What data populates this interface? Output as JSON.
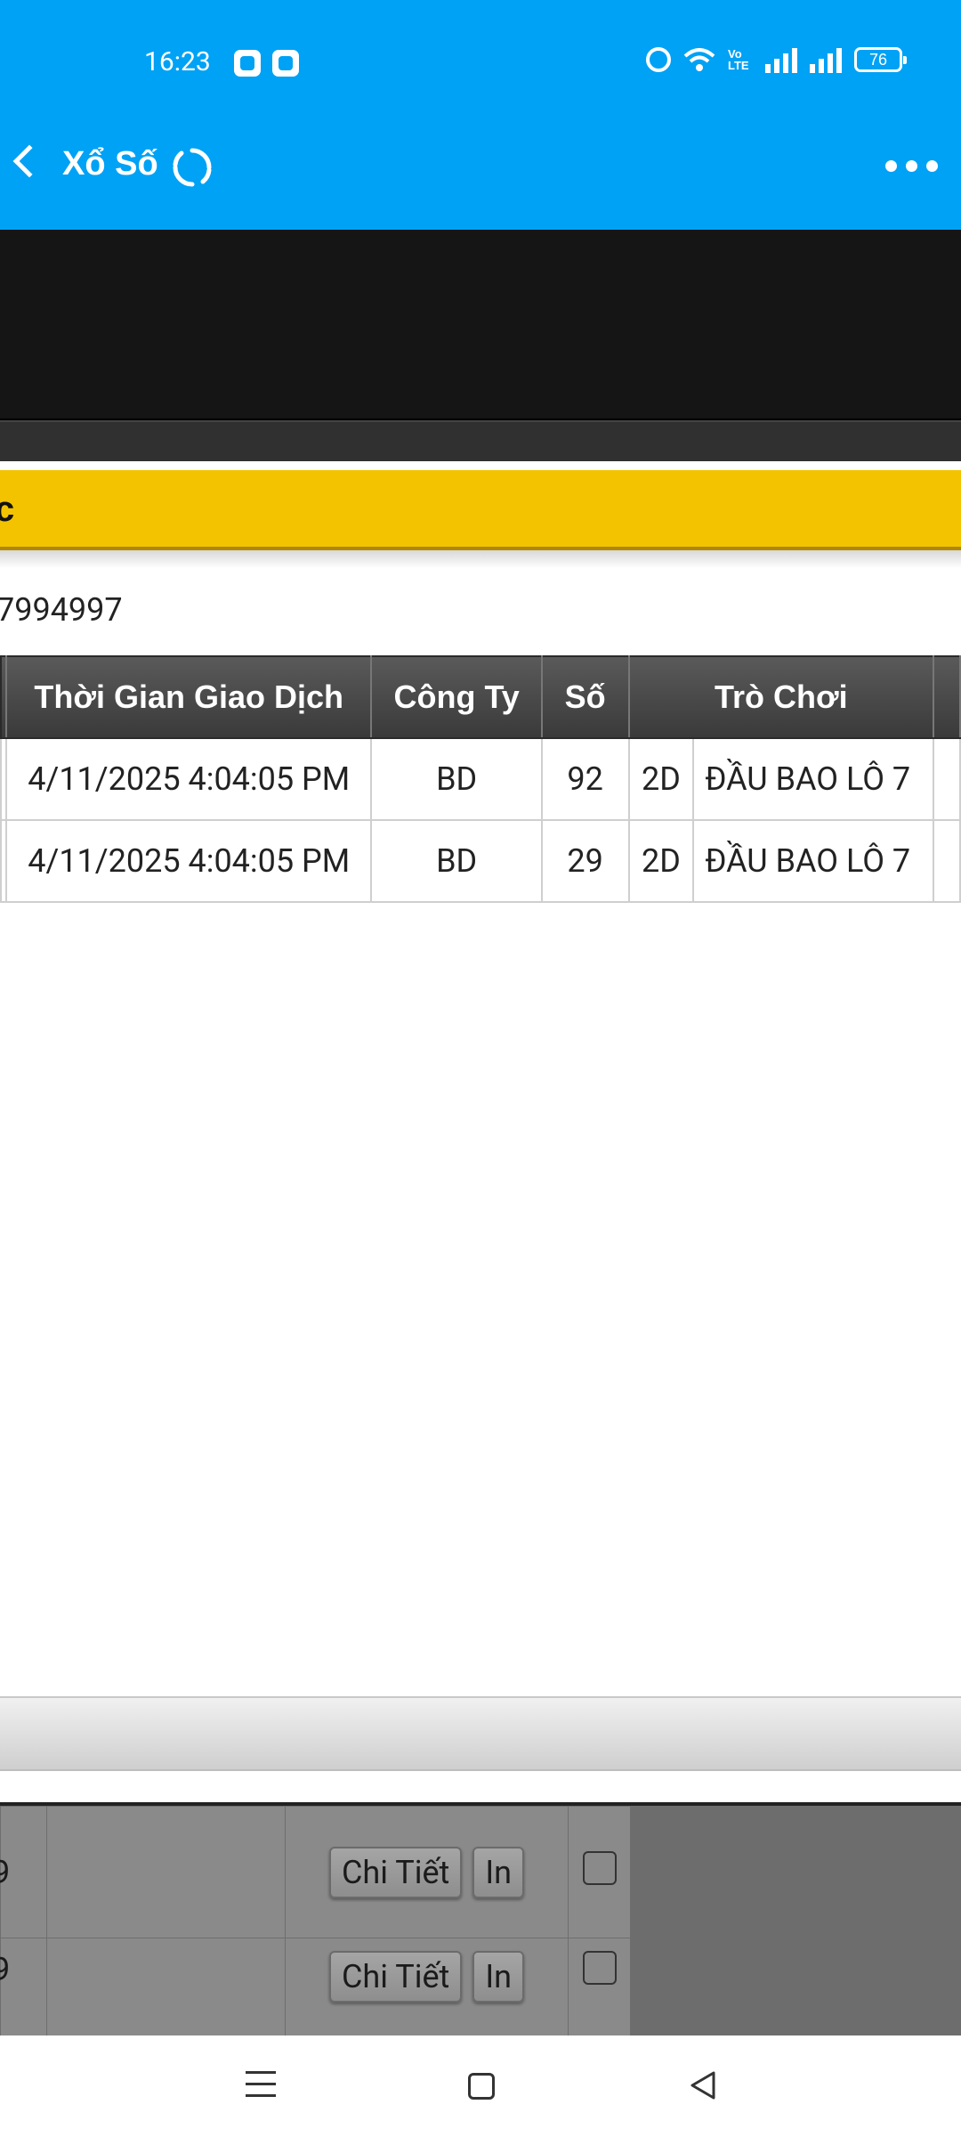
{
  "status_bar": {
    "time": "16:23",
    "battery": "76",
    "volte": "Vo LTE",
    "icons": [
      "app-notification-icon",
      "app-notification-icon",
      "alarm-icon",
      "wifi-icon",
      "volte-icon",
      "signal-icon",
      "signal-icon",
      "battery-icon"
    ]
  },
  "header": {
    "title": "Xổ Số",
    "icons": [
      "back-icon",
      "refresh-icon",
      "more-icon"
    ]
  },
  "yellow_bar": {
    "text": "c"
  },
  "account": {
    "id": "7994997"
  },
  "table": {
    "headers": [
      "Thời Gian Giao Dịch",
      "Công Ty",
      "Số",
      "Trò Chơi"
    ],
    "rows": [
      {
        "time": "4/11/2025 4:04:05 PM",
        "company": "BD",
        "number": "92",
        "digits": "2D",
        "game": "ĐẦU BAO LÔ 7"
      },
      {
        "time": "4/11/2025 4:04:05 PM",
        "company": "BD",
        "number": "29",
        "digits": "2D",
        "game": "ĐẦU BAO LÔ 7"
      }
    ]
  },
  "lower_table": {
    "rows": [
      {
        "col0": "9",
        "detail_label": "Chi Tiết",
        "print_label": "In"
      },
      {
        "col0": "9",
        "detail_label": "Chi Tiết",
        "print_label": "In"
      }
    ]
  },
  "colors": {
    "header_blue": "#00a2f5",
    "yellow": "#f3c300",
    "table_header": "#4a4a4a"
  }
}
